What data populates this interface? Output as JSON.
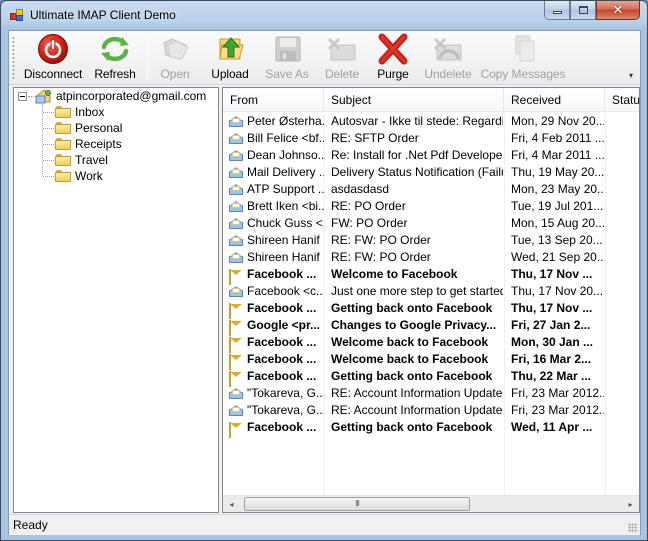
{
  "window": {
    "title": "Ultimate IMAP Client Demo",
    "caption_buttons": {
      "minimize": "minimize",
      "maximize": "maximize",
      "close": "close"
    }
  },
  "toolbar": {
    "buttons": [
      {
        "id": "disconnect",
        "label": "Disconnect",
        "icon": "power-icon",
        "enabled": true
      },
      {
        "id": "refresh",
        "label": "Refresh",
        "icon": "refresh-icon",
        "enabled": true
      },
      {
        "id": "open",
        "label": "Open",
        "icon": "open-icon",
        "enabled": false
      },
      {
        "id": "upload",
        "label": "Upload",
        "icon": "upload-icon",
        "enabled": true
      },
      {
        "id": "save-as",
        "label": "Save As",
        "icon": "floppy-icon",
        "enabled": false
      },
      {
        "id": "delete",
        "label": "Delete",
        "icon": "delete-icon",
        "enabled": false
      },
      {
        "id": "purge",
        "label": "Purge",
        "icon": "red-x-icon",
        "enabled": true
      },
      {
        "id": "undelete",
        "label": "Undelete",
        "icon": "undelete-icon",
        "enabled": false
      },
      {
        "id": "copy-messages",
        "label": "Copy Messages",
        "icon": "copy-icon",
        "enabled": false
      }
    ],
    "overflow": "▾"
  },
  "tree": {
    "account": "atpincorporated@gmail.com",
    "folders": [
      "Inbox",
      "Personal",
      "Receipts",
      "Travel",
      "Work"
    ]
  },
  "list": {
    "columns": [
      "From",
      "Subject",
      "Received",
      "Status"
    ],
    "rows": [
      {
        "from": "Peter Østerha...",
        "subject": "Autosvar - Ikke til stede: Regardi...",
        "received": "Mon, 29 Nov 20...",
        "status": "",
        "unread": false
      },
      {
        "from": "Bill Felice <bf...",
        "subject": "RE: SFTP Order",
        "received": "Fri, 4 Feb 2011 ...",
        "status": "",
        "unread": false
      },
      {
        "from": "Dean Johnso...",
        "subject": "Re: Install for .Net Pdf Developer ...",
        "received": "Fri, 4 Mar 2011 ...",
        "status": "",
        "unread": false
      },
      {
        "from": "Mail Delivery ...",
        "subject": "Delivery Status Notification (Failure)",
        "received": "Thu, 19 May 20...",
        "status": "",
        "unread": false
      },
      {
        "from": "ATP Support ...",
        "subject": "asdasdasd",
        "received": "Mon, 23 May 20...",
        "status": "",
        "unread": false
      },
      {
        "from": "Brett Iken <bi...",
        "subject": "RE: PO Order",
        "received": "Tue, 19 Jul 201...",
        "status": "",
        "unread": false
      },
      {
        "from": "Chuck Guss <...",
        "subject": "FW: PO Order",
        "received": "Mon, 15 Aug 20...",
        "status": "",
        "unread": false
      },
      {
        "from": "Shireen Hanif ...",
        "subject": "RE: FW: PO Order",
        "received": "Tue, 13 Sep 20...",
        "status": "",
        "unread": false
      },
      {
        "from": "Shireen Hanif ...",
        "subject": "RE: FW: PO Order",
        "received": "Wed, 21 Sep 20...",
        "status": "",
        "unread": false
      },
      {
        "from": "Facebook ...",
        "subject": "Welcome to Facebook",
        "received": "Thu, 17 Nov ...",
        "status": "",
        "unread": true
      },
      {
        "from": "Facebook <c...",
        "subject": "Just one more step to get started ...",
        "received": "Thu, 17 Nov 20...",
        "status": "",
        "unread": false
      },
      {
        "from": "Facebook ...",
        "subject": "Getting back onto Facebook",
        "received": "Thu, 17 Nov ...",
        "status": "",
        "unread": true
      },
      {
        "from": "Google <pr...",
        "subject": "Changes to Google Privacy...",
        "received": "Fri, 27 Jan 2...",
        "status": "",
        "unread": true
      },
      {
        "from": "Facebook ...",
        "subject": "Welcome back to Facebook",
        "received": "Mon, 30 Jan ...",
        "status": "",
        "unread": true
      },
      {
        "from": "Facebook ...",
        "subject": "Welcome back to Facebook",
        "received": "Fri, 16 Mar 2...",
        "status": "",
        "unread": true
      },
      {
        "from": "Facebook ...",
        "subject": "Getting back onto Facebook",
        "received": "Thu, 22 Mar ...",
        "status": "",
        "unread": true
      },
      {
        "from": "\"Tokareva, G...",
        "subject": "RE: Account Information Updated",
        "received": "Fri, 23 Mar 2012...",
        "status": "",
        "unread": false
      },
      {
        "from": "\"Tokareva, G...",
        "subject": "RE: Account Information Updated",
        "received": "Fri, 23 Mar 2012...",
        "status": "",
        "unread": false
      },
      {
        "from": "Facebook ...",
        "subject": "Getting back onto Facebook",
        "received": "Wed, 11 Apr ...",
        "status": "",
        "unread": true
      }
    ],
    "scrollbar": {
      "left_arrow": "◂",
      "right_arrow": "▸",
      "thumb_grip": "III",
      "position": 0
    }
  },
  "statusbar": {
    "text": "Ready"
  }
}
